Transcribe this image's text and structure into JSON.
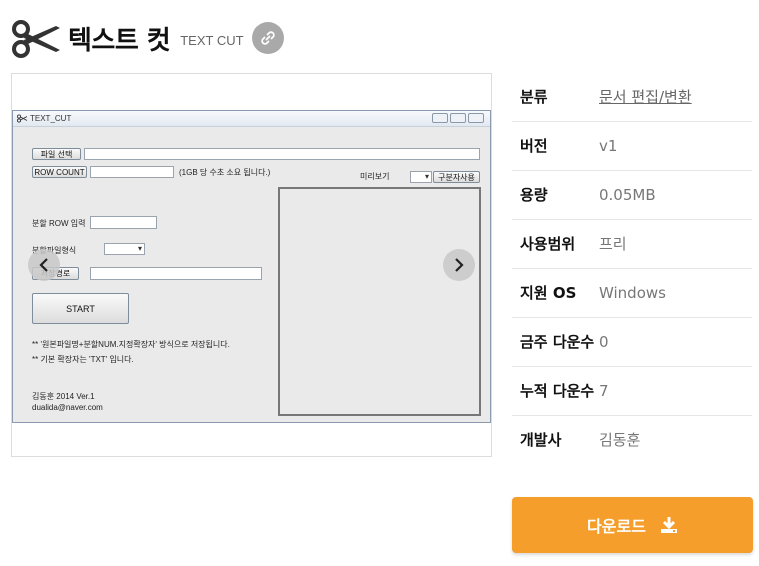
{
  "header": {
    "title": "텍스트 컷",
    "subtitle": "TEXT CUT",
    "icons": {
      "logo": "scissors-icon",
      "link": "link-icon"
    }
  },
  "gallery": {
    "screenshot": {
      "window_title": "TEXT_CUT",
      "file_select_button": "파일 선택",
      "row_count_button": "ROW COUNT",
      "row_count_hint": "(1GB 당 수초 소요 됩니다.)",
      "preview_label": "미리보기",
      "separator_button": "구분자사용",
      "split_row_label": "분할 ROW 입력",
      "split_format_label": "분할파일형식",
      "save_path_button": "저장경로",
      "start_button": "START",
      "note1": "** '원본파일명+분할NUM.지정확장자' 방식으로 저장됩니다.",
      "note2": "** 기본 확장자는 'TXT' 입니다.",
      "author": "김동훈 2014 Ver.1",
      "email": "dualida@naver.com"
    },
    "icons": {
      "prev": "chevron-left-icon",
      "next": "chevron-right-icon"
    }
  },
  "info": [
    {
      "key": "분류",
      "value": "문서 편집/변환",
      "is_link": true
    },
    {
      "key": "버전",
      "value": "v1"
    },
    {
      "key": "용량",
      "value": "0.05MB"
    },
    {
      "key": "사용범위",
      "value": "프리"
    },
    {
      "key": "지원 OS",
      "value": "Windows"
    },
    {
      "key": "금주 다운수",
      "value": "0"
    },
    {
      "key": "누적 다운수",
      "value": "7"
    },
    {
      "key": "개발사",
      "value": "김동훈"
    }
  ],
  "download": {
    "label": "다운로드",
    "icon": "download-icon",
    "color": "#f59e2b"
  }
}
